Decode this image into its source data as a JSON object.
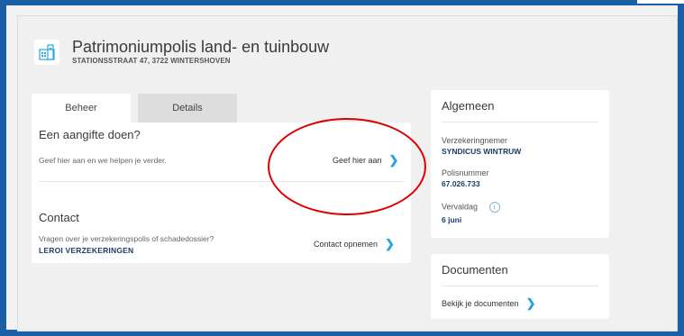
{
  "policy": {
    "title": "Patrimoniumpolis land- en tuinbouw",
    "address": "STATIONSSTRAAT 47, 3722 WINTERSHOVEN",
    "icon": "building-icon"
  },
  "tabs": [
    {
      "label": "Beheer",
      "active": true
    },
    {
      "label": "Details",
      "active": false
    }
  ],
  "aangifte": {
    "title": "Een aangifte doen?",
    "text": "Geef hier aan en we helpen je verder.",
    "action": "Geef hier aan"
  },
  "contact": {
    "title": "Contact",
    "text": "Vragen over je verzekeringspolis of schadedossier?",
    "company": "LEROI VERZEKERINGEN",
    "action": "Contact opnemen"
  },
  "algemeen": {
    "title": "Algemeen",
    "insurer_label": "Verzekeringnemer",
    "insurer_value": "SYNDICUS WINTRUW",
    "policy_label": "Polisnummer",
    "policy_value": "67.026.733",
    "due_label": "Vervaldag",
    "due_value": "6 juni",
    "info_glyph": "i"
  },
  "documenten": {
    "title": "Documenten",
    "action": "Bekijk je documenten"
  },
  "colors": {
    "frame_border": "#1a5ea7",
    "accent_chevron": "#29a3dd",
    "value_text": "#1a3c66",
    "annotation": "#e00000"
  }
}
